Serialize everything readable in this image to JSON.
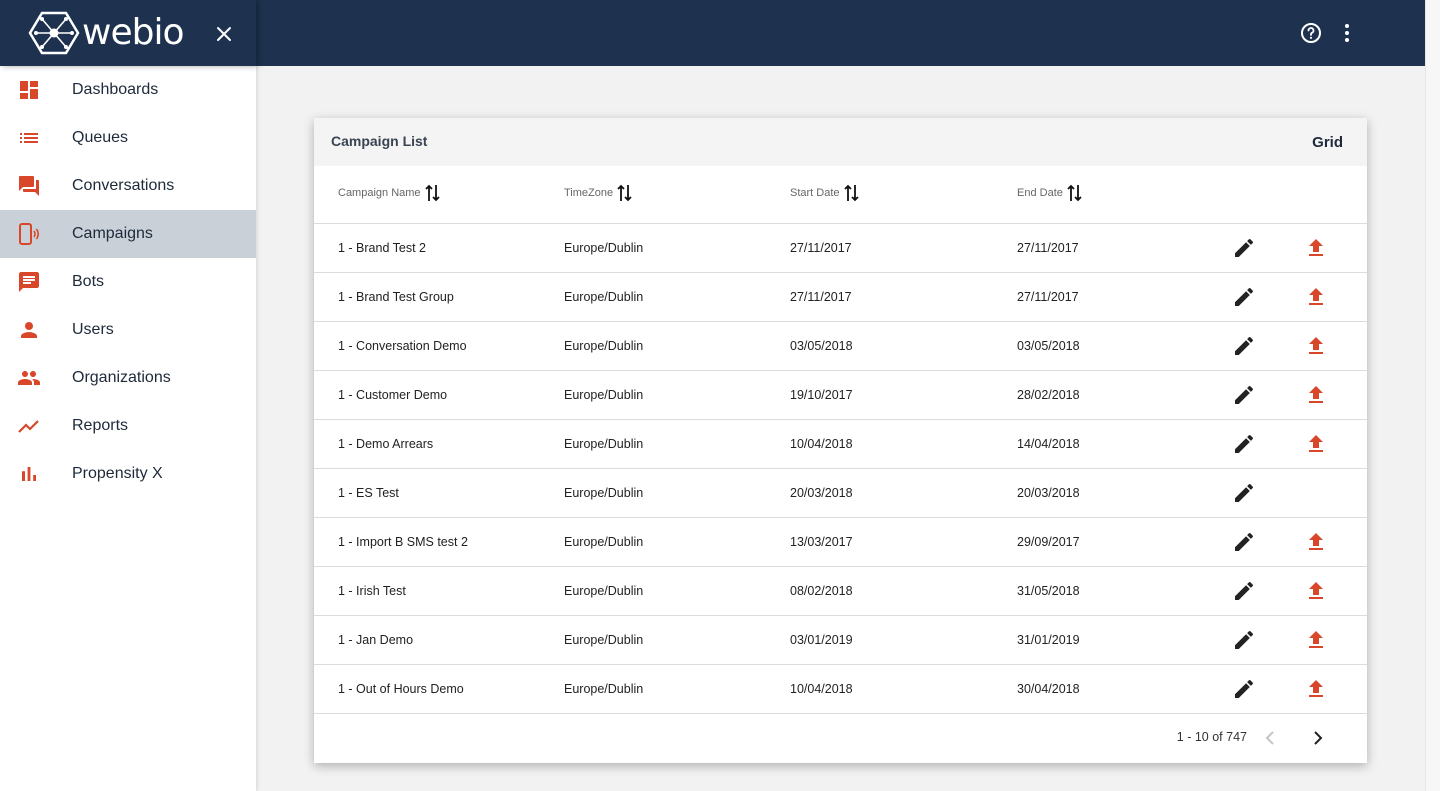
{
  "app": {
    "logo_text": "webio",
    "brand_color": "#1e3250",
    "accent_color": "#d9472b"
  },
  "header": {
    "close_icon": "close-icon",
    "help_icon": "help-circle-icon",
    "more_icon": "more-vert-icon"
  },
  "sidebar": {
    "items": [
      {
        "label": "Dashboards",
        "icon": "dashboard-icon"
      },
      {
        "label": "Queues",
        "icon": "list-icon"
      },
      {
        "label": "Conversations",
        "icon": "forum-icon"
      },
      {
        "label": "Campaigns",
        "icon": "phone-ring-icon",
        "active": true
      },
      {
        "label": "Bots",
        "icon": "chat-icon"
      },
      {
        "label": "Users",
        "icon": "person-icon"
      },
      {
        "label": "Organizations",
        "icon": "people-icon"
      },
      {
        "label": "Reports",
        "icon": "trending-icon"
      },
      {
        "label": "Propensity X",
        "icon": "bar-chart-icon"
      }
    ]
  },
  "card": {
    "title": "Campaign List",
    "view_toggle": "Grid"
  },
  "table": {
    "columns": [
      "Campaign Name",
      "TimeZone",
      "Start Date",
      "End Date"
    ],
    "rows": [
      {
        "name": "1 - Brand Test 2",
        "timezone": "Europe/Dublin",
        "start": "27/11/2017",
        "end": "27/11/2017",
        "upload": true
      },
      {
        "name": "1 - Brand Test Group",
        "timezone": "Europe/Dublin",
        "start": "27/11/2017",
        "end": "27/11/2017",
        "upload": true
      },
      {
        "name": "1 - Conversation Demo",
        "timezone": "Europe/Dublin",
        "start": "03/05/2018",
        "end": "03/05/2018",
        "upload": true
      },
      {
        "name": "1 - Customer Demo",
        "timezone": "Europe/Dublin",
        "start": "19/10/2017",
        "end": "28/02/2018",
        "upload": true
      },
      {
        "name": "1 - Demo Arrears",
        "timezone": "Europe/Dublin",
        "start": "10/04/2018",
        "end": "14/04/2018",
        "upload": true
      },
      {
        "name": "1 - ES Test",
        "timezone": "Europe/Dublin",
        "start": "20/03/2018",
        "end": "20/03/2018",
        "upload": false
      },
      {
        "name": "1 - Import B SMS test 2",
        "timezone": "Europe/Dublin",
        "start": "13/03/2017",
        "end": "29/09/2017",
        "upload": true
      },
      {
        "name": "1 - Irish Test",
        "timezone": "Europe/Dublin",
        "start": "08/02/2018",
        "end": "31/05/2018",
        "upload": true
      },
      {
        "name": "1 - Jan Demo",
        "timezone": "Europe/Dublin",
        "start": "03/01/2019",
        "end": "31/01/2019",
        "upload": true
      },
      {
        "name": "1 - Out of Hours Demo",
        "timezone": "Europe/Dublin",
        "start": "10/04/2018",
        "end": "30/04/2018",
        "upload": true
      }
    ]
  },
  "pagination": {
    "range_text": "1 - 10 of 747"
  }
}
